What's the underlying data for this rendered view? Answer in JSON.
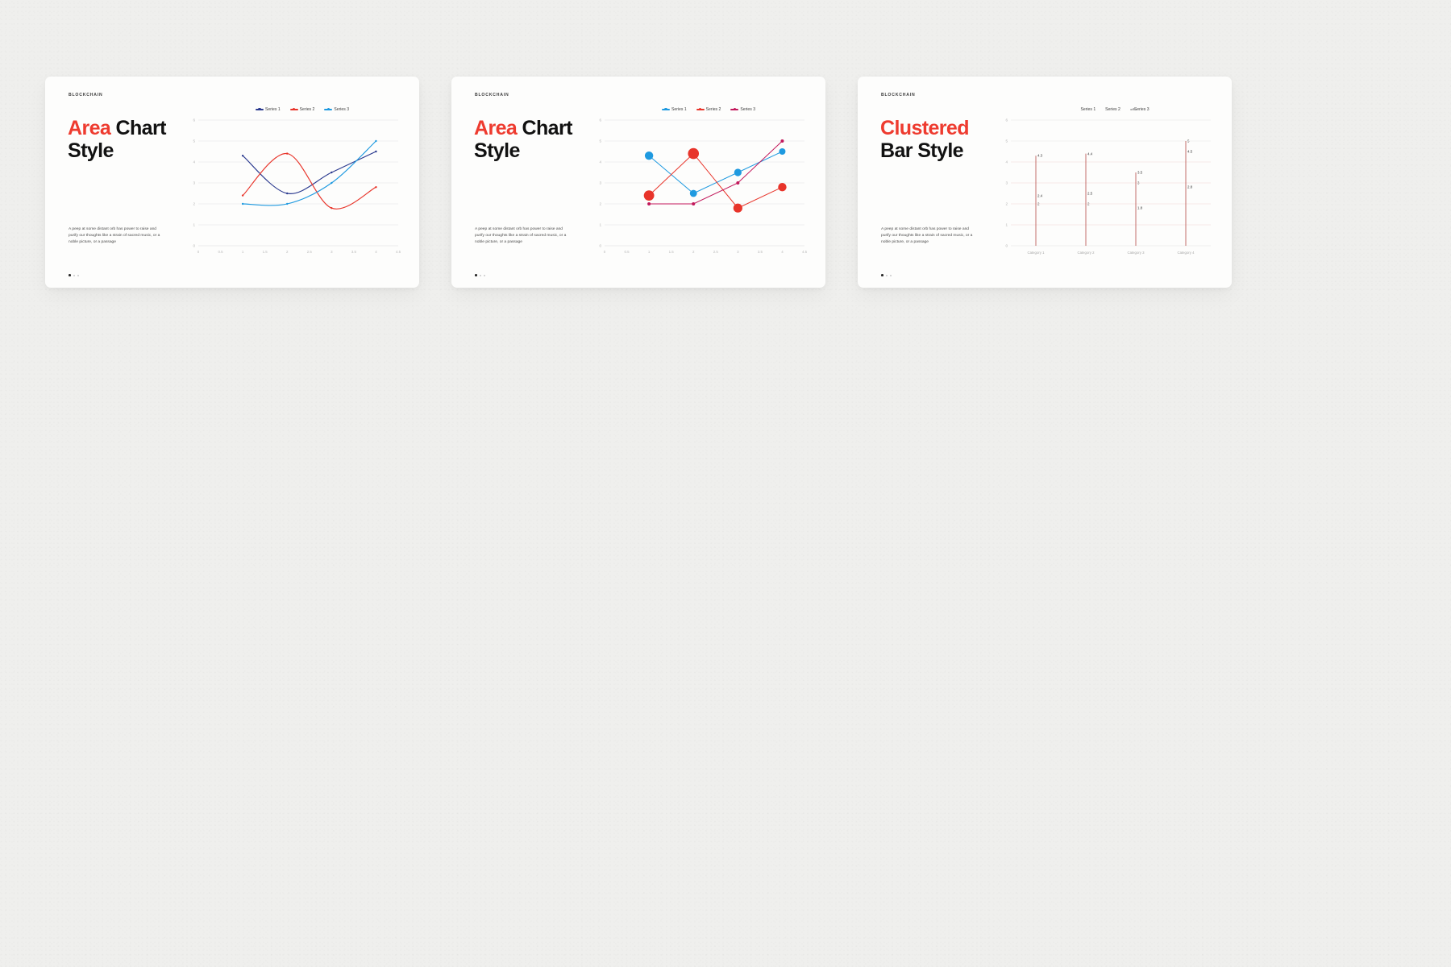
{
  "deck": {
    "kicker": "BLOCKCHAIN",
    "body_copy": "A peep at some distant orb has power to raise and purify our thoughts like a strain of sacred music, or a noble picture, or a passage",
    "colors": {
      "accent_red": "#ee3b2f",
      "series1_navy": "#2b3a8f",
      "series1_blue": "#1f9ae0",
      "series2_red": "#e8342a",
      "series3_blue": "#1f9ae0",
      "bar_red": "#e8342a",
      "crimson": "#c2185b",
      "text_dark": "#111111"
    }
  },
  "slides": [
    {
      "id": "area-chart-style-line",
      "title_accent": "Area",
      "title_rest": " Chart",
      "title_line2": "Style",
      "chart_data": {
        "type": "line",
        "title": "Area Chart Style",
        "legend": [
          "Series 1",
          "Series 2",
          "Series 3"
        ],
        "legend_position": "top-center",
        "grid": true,
        "xlabel": "",
        "ylabel": "",
        "xlim": [
          0,
          4.5
        ],
        "ylim": [
          0,
          6
        ],
        "xticks": [
          "0",
          "0.5",
          "1",
          "1.5",
          "2",
          "2.5",
          "3",
          "3.5",
          "4",
          "4.5"
        ],
        "yticks": [
          "0",
          "1",
          "2",
          "3",
          "4",
          "5",
          "6"
        ],
        "x": [
          1,
          2,
          3,
          4
        ],
        "series": [
          {
            "name": "Series 1",
            "color": "#2b3a8f",
            "values": [
              4.3,
              2.5,
              3.5,
              4.5
            ]
          },
          {
            "name": "Series 2",
            "color": "#e8342a",
            "values": [
              2.4,
              4.4,
              1.8,
              2.8
            ]
          },
          {
            "name": "Series 3",
            "color": "#1f9ae0",
            "values": [
              2.0,
              2.0,
              3.0,
              5.0
            ]
          }
        ]
      }
    },
    {
      "id": "area-chart-style-bubble",
      "title_accent": "Area",
      "title_rest": " Chart",
      "title_line2": "Style",
      "chart_data": {
        "type": "scatter",
        "title": "Area Chart Style",
        "legend": [
          "Series 1",
          "Series 2",
          "Series 3"
        ],
        "legend_position": "top-center",
        "grid": true,
        "xlabel": "",
        "ylabel": "",
        "xlim": [
          0,
          4.5
        ],
        "ylim": [
          0,
          6
        ],
        "xticks": [
          "0",
          "0.5",
          "1",
          "1.5",
          "2",
          "2.5",
          "3",
          "3.5",
          "4",
          "4.5"
        ],
        "yticks": [
          "0",
          "1",
          "2",
          "3",
          "4",
          "5",
          "6"
        ],
        "x": [
          1,
          2,
          3,
          4
        ],
        "series": [
          {
            "name": "Series 1",
            "color": "#1f9ae0",
            "values": [
              4.3,
              2.5,
              3.5,
              4.5
            ],
            "sizes": [
              5.2,
              4.4,
              4.6,
              4.0
            ]
          },
          {
            "name": "Series 2",
            "color": "#e8342a",
            "values": [
              2.4,
              4.4,
              1.8,
              2.8
            ],
            "sizes": [
              6.4,
              6.8,
              5.6,
              5.2
            ]
          },
          {
            "name": "Series 3",
            "color": "#c2185b",
            "values": [
              2.0,
              2.0,
              3.0,
              5.0
            ],
            "sizes": [
              2.0,
              2.0,
              2.0,
              2.0
            ]
          }
        ]
      }
    },
    {
      "id": "clustered-bar-style",
      "title_accent": "Clustered",
      "title_rest": "",
      "title_line2": "Bar Style",
      "chart_data": {
        "type": "bar",
        "title": "Clustered Bar Style",
        "legend": [
          "Series 1",
          "Series 2",
          "Series 3"
        ],
        "legend_position": "top-center",
        "grid": true,
        "xlabel": "",
        "ylabel": "",
        "ylim": [
          0,
          6
        ],
        "yticks": [
          "0",
          "1",
          "2",
          "3",
          "4",
          "5",
          "6"
        ],
        "categories": [
          "Category 1",
          "Category 2",
          "Category 3",
          "Category 4"
        ],
        "series": [
          {
            "name": "Series 1",
            "color": "#e8342a",
            "values": [
              4.3,
              4.4,
              3.5,
              5
            ]
          },
          {
            "name": "Series 2",
            "color": "#e8342a",
            "values": [
              2.4,
              2.5,
              3,
              4.5
            ]
          },
          {
            "name": "Series 3",
            "color": "#e8342a",
            "values": [
              2,
              2,
              1.8,
              2.8
            ]
          }
        ],
        "value_labels": [
          [
            "4.3",
            "2.4",
            "2"
          ],
          [
            "4.4",
            "2.5",
            "2"
          ],
          [
            "3.5",
            "3",
            "1.8"
          ],
          [
            "5",
            "4.5",
            "2.8"
          ]
        ]
      }
    }
  ]
}
